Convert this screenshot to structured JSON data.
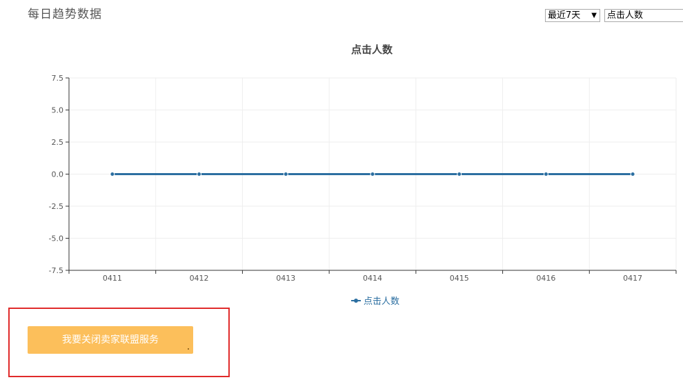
{
  "page": {
    "title": "每日趋势数据"
  },
  "filters": {
    "range_selected": "最近7天",
    "metric_selected": "点击人数"
  },
  "actions": {
    "close_service_label": "我要关闭卖家联盟服务"
  },
  "colors": {
    "series": "#2c6fa1",
    "button": "#fcbf5b",
    "highlight": "#e02a2a",
    "grid": "#eeeeee",
    "axis": "#333333"
  },
  "chart_data": {
    "type": "line",
    "title": "点击人数",
    "categories": [
      "0411",
      "0412",
      "0413",
      "0414",
      "0415",
      "0416",
      "0417"
    ],
    "series": [
      {
        "name": "点击人数",
        "values": [
          0,
          0,
          0,
          0,
          0,
          0,
          0
        ]
      }
    ],
    "ylim": [
      -7.5,
      7.5
    ],
    "yticks": [
      "7.5",
      "5.0",
      "2.5",
      "0.0",
      "-2.5",
      "-5.0",
      "-7.5"
    ],
    "grid": true,
    "legend_position": "bottom-center"
  }
}
